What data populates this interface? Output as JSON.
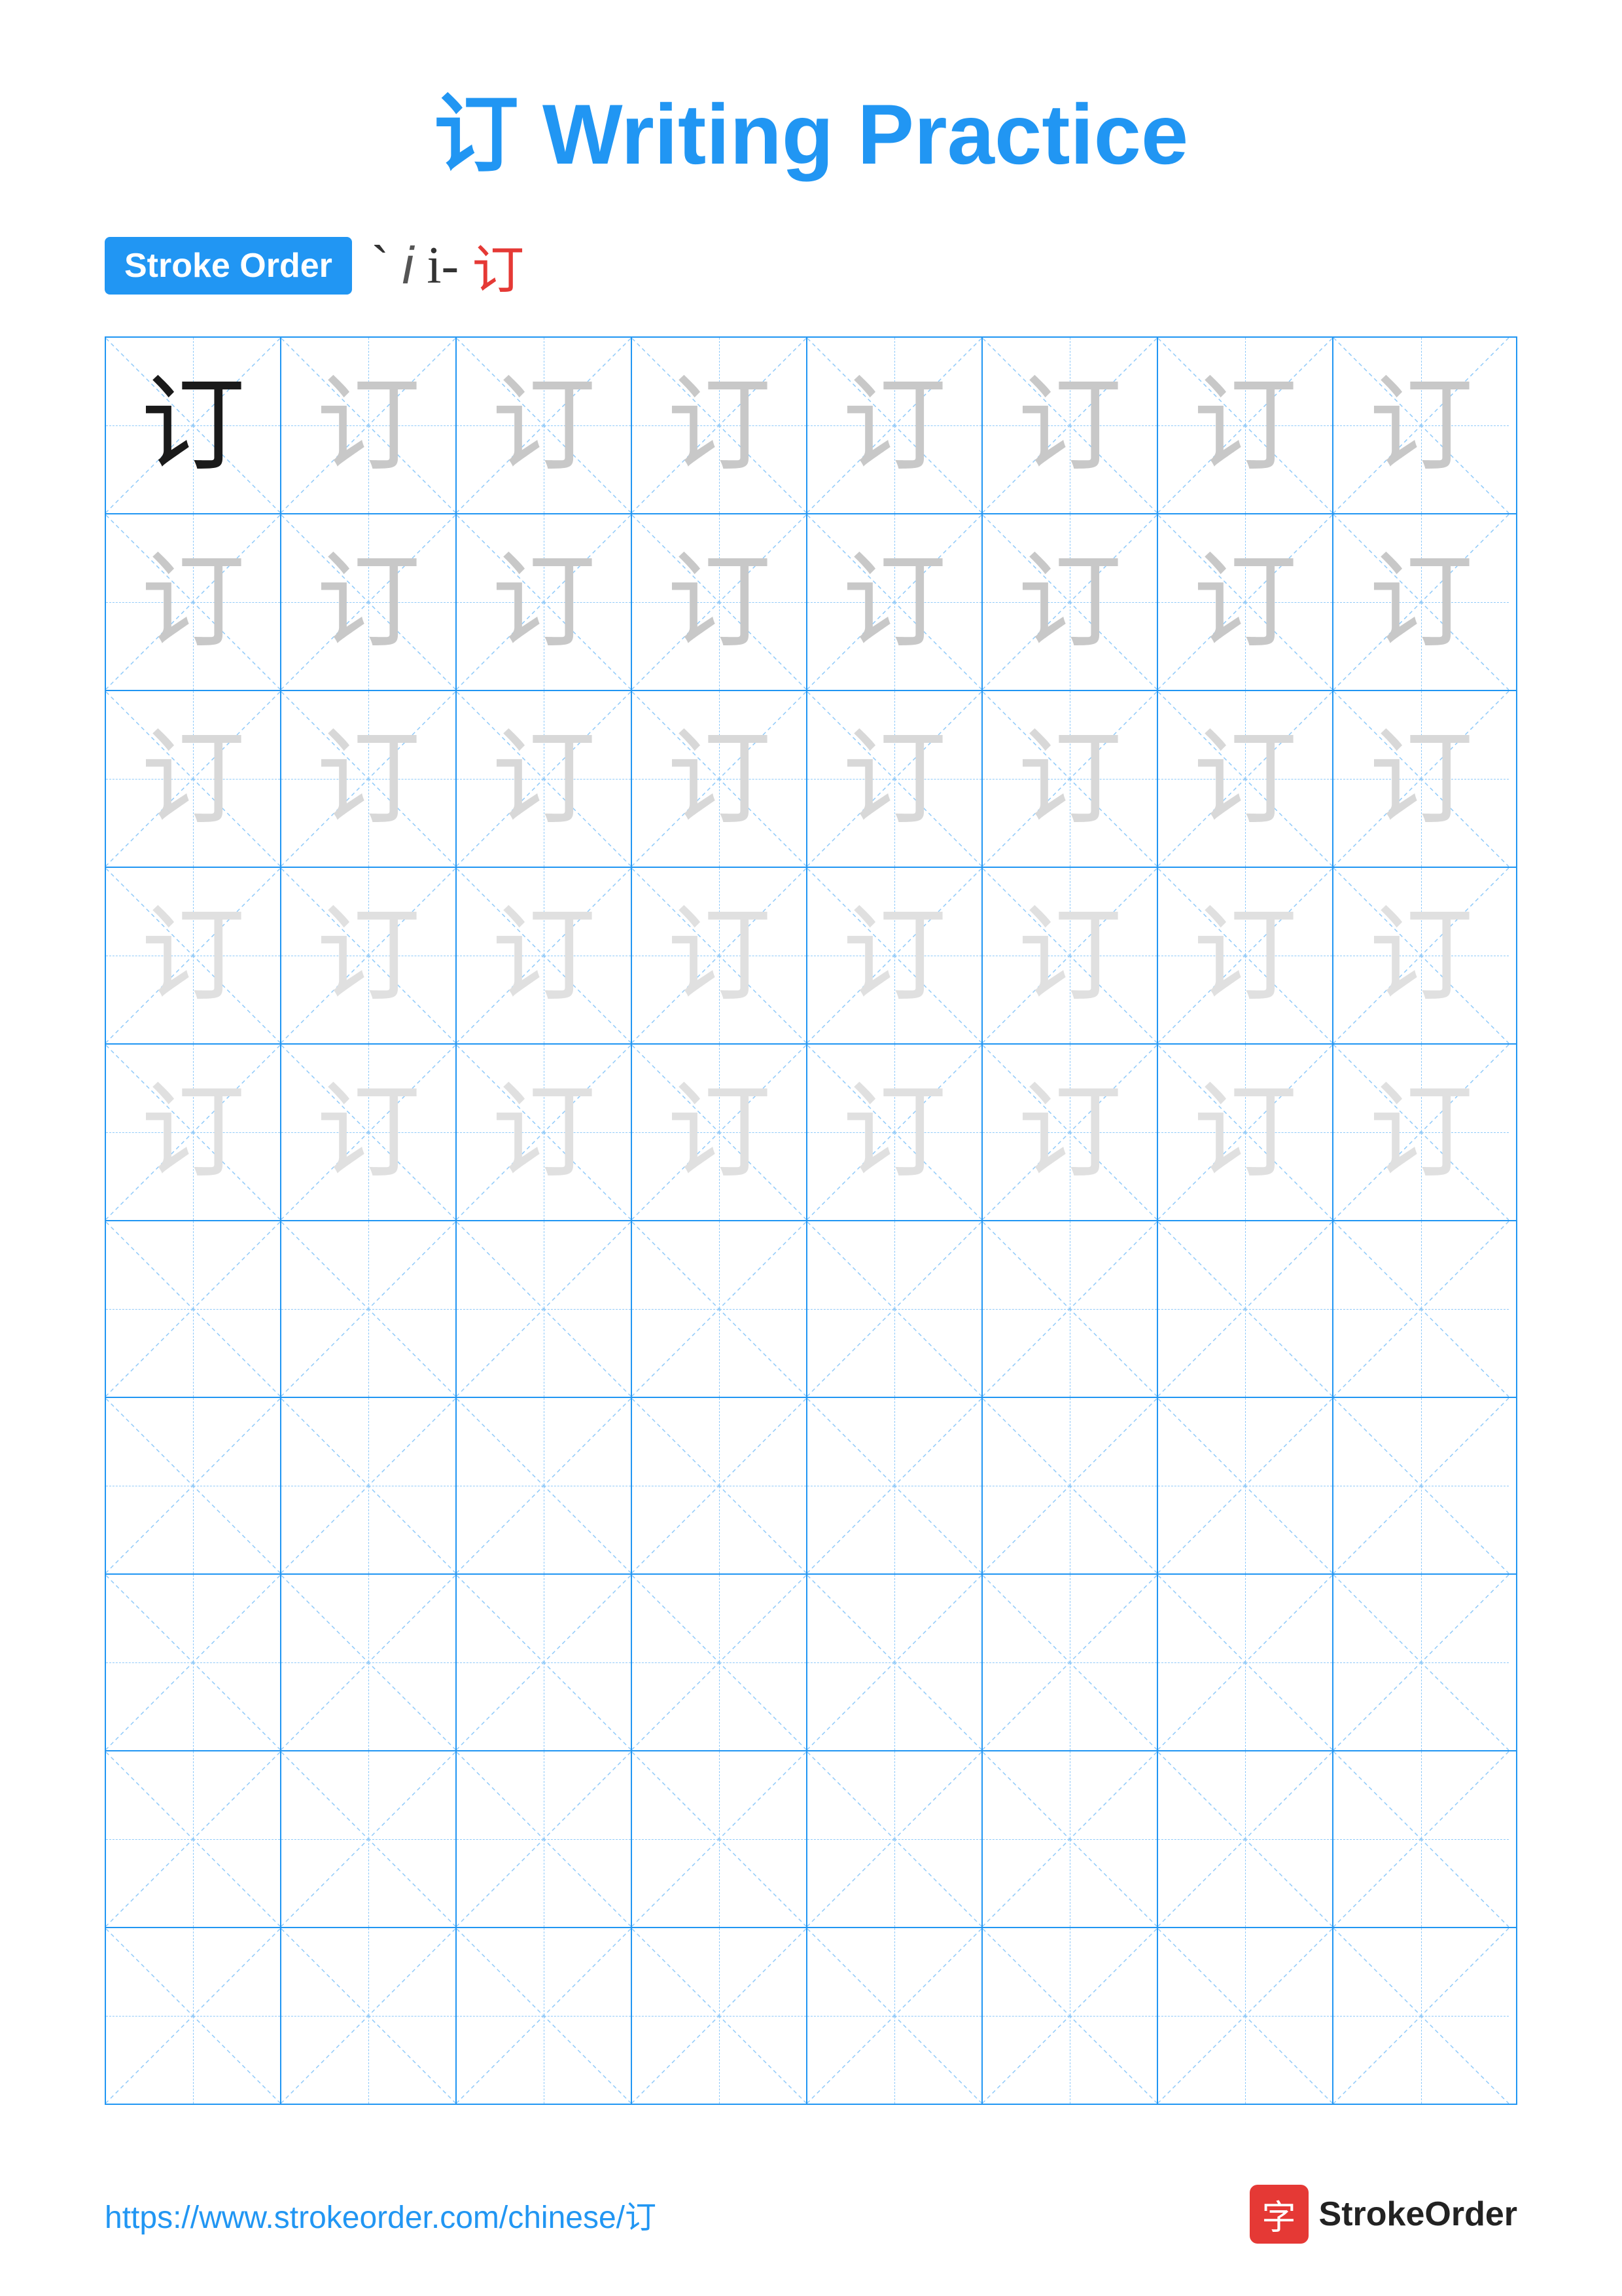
{
  "title": {
    "prefix": "订",
    "suffix": " Writing Practice"
  },
  "stroke_order": {
    "badge_label": "Stroke Order",
    "sequence": [
      "`",
      "i",
      "i-",
      "订"
    ]
  },
  "grid": {
    "rows": 10,
    "cols": 8,
    "char": "订",
    "filled_rows": 5,
    "row_opacities": [
      "dark",
      "light1",
      "light2",
      "light3",
      "light3"
    ]
  },
  "footer": {
    "url": "https://www.strokeorder.com/chinese/订",
    "logo_char": "字",
    "logo_text": "StrokeOrder"
  }
}
